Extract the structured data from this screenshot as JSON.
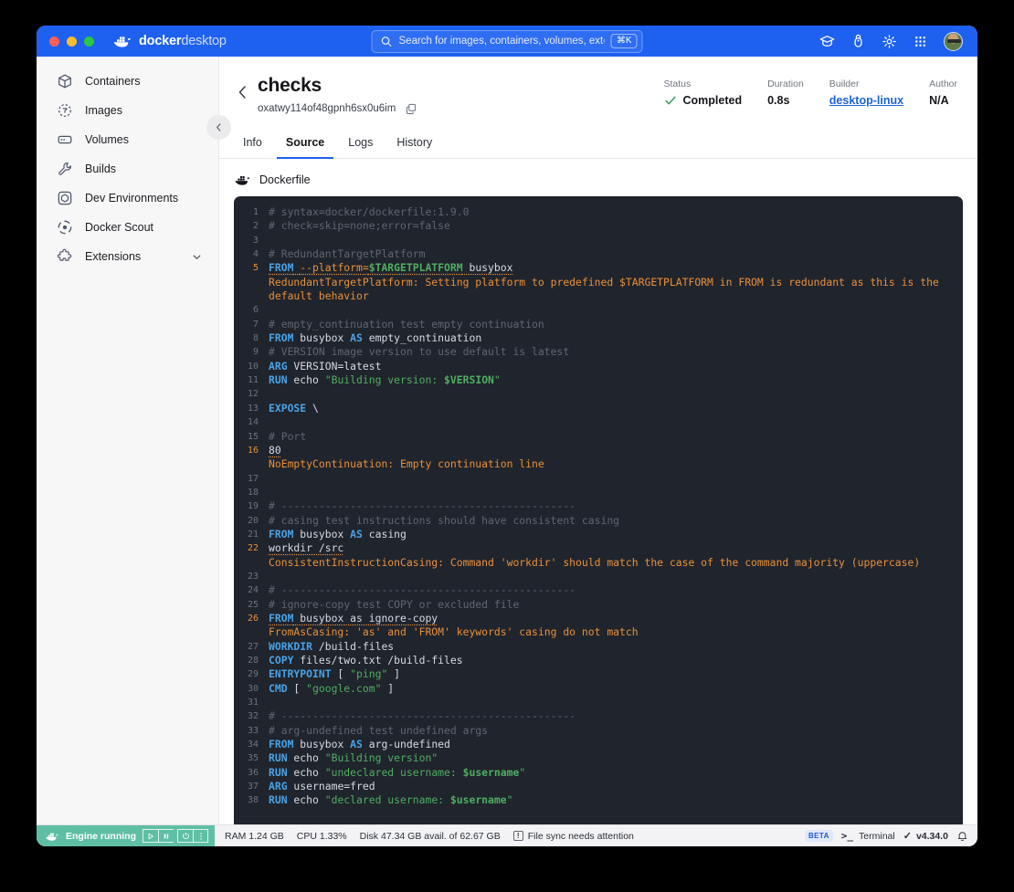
{
  "titlebar": {
    "brand_bold": "docker",
    "brand_light": "desktop",
    "search_placeholder": "Search for images, containers, volumes, extensi…",
    "search_shortcut": "⌘K",
    "icons": [
      "graduation-cap-icon",
      "bug-icon",
      "gear-icon",
      "grid-apps-icon",
      "avatar"
    ]
  },
  "sidebar": {
    "items": [
      {
        "label": "Containers",
        "icon": "container-box-icon"
      },
      {
        "label": "Images",
        "icon": "images-icon"
      },
      {
        "label": "Volumes",
        "icon": "volumes-icon"
      },
      {
        "label": "Builds",
        "icon": "wrench-icon"
      },
      {
        "label": "Dev Environments",
        "icon": "dev-environments-icon"
      },
      {
        "label": "Docker Scout",
        "icon": "docker-scout-icon"
      },
      {
        "label": "Extensions",
        "icon": "puzzle-icon",
        "chevron": "chevron-down-icon"
      }
    ]
  },
  "header": {
    "title": "checks",
    "build_id": "oxatwy114of48gpnh6sx0u6im",
    "copy_icon": "copy-icon",
    "meta": [
      {
        "label": "Status",
        "value": "Completed",
        "icon": "check-icon"
      },
      {
        "label": "Duration",
        "value": "0.8s"
      },
      {
        "label": "Builder",
        "value": "desktop-linux",
        "link": true
      },
      {
        "label": "Author",
        "value": "N/A"
      }
    ]
  },
  "tabs": [
    {
      "label": "Info",
      "active": false
    },
    {
      "label": "Source",
      "active": true
    },
    {
      "label": "Logs",
      "active": false
    },
    {
      "label": "History",
      "active": false
    }
  ],
  "file": {
    "name": "Dockerfile",
    "icon": "docker-whale-icon"
  },
  "code": {
    "lines": [
      {
        "n": "1",
        "tokens": [
          [
            "t-comment",
            "# syntax=docker/dockerfile:1.9.0"
          ]
        ]
      },
      {
        "n": "2",
        "tokens": [
          [
            "t-comment",
            "# check=skip=none;error=false"
          ]
        ]
      },
      {
        "n": "3",
        "tokens": []
      },
      {
        "n": "4",
        "tokens": [
          [
            "t-comment",
            "# RedundantTargetPlatform"
          ]
        ]
      },
      {
        "n": "5",
        "warn": true,
        "underline": true,
        "tokens": [
          [
            "t-kw",
            "FROM"
          ],
          [
            "t-plain",
            " "
          ],
          [
            "t-flag",
            "--platform="
          ],
          [
            "t-var",
            "$TARGETPLATFORM"
          ],
          [
            "t-white",
            " busybox"
          ]
        ]
      },
      {
        "msg": "RedundantTargetPlatform: Setting platform to predefined $TARGETPLATFORM in FROM is redundant as this is the default behavior"
      },
      {
        "n": "6",
        "tokens": []
      },
      {
        "n": "7",
        "tokens": [
          [
            "t-comment",
            "# empty_continuation test empty continuation"
          ]
        ]
      },
      {
        "n": "8",
        "tokens": [
          [
            "t-kw",
            "FROM"
          ],
          [
            "t-white",
            " busybox "
          ],
          [
            "t-kw",
            "AS"
          ],
          [
            "t-white",
            " empty_continuation"
          ]
        ]
      },
      {
        "n": "9",
        "tokens": [
          [
            "t-comment",
            "# VERSION image version to use default is latest"
          ]
        ]
      },
      {
        "n": "10",
        "tokens": [
          [
            "t-kw",
            "ARG"
          ],
          [
            "t-white",
            " VERSION=latest"
          ]
        ]
      },
      {
        "n": "11",
        "tokens": [
          [
            "t-kw",
            "RUN"
          ],
          [
            "t-white",
            " echo "
          ],
          [
            "t-str",
            "\"Building version: "
          ],
          [
            "t-var",
            "$VERSION"
          ],
          [
            "t-str",
            "\""
          ]
        ]
      },
      {
        "n": "12",
        "tokens": []
      },
      {
        "n": "13",
        "tokens": [
          [
            "t-kw",
            "EXPOSE"
          ],
          [
            "t-white",
            " \\"
          ]
        ]
      },
      {
        "n": "14",
        "tokens": []
      },
      {
        "n": "15",
        "tokens": [
          [
            "t-comment",
            "# Port"
          ]
        ]
      },
      {
        "n": "16",
        "warn": true,
        "underline": true,
        "tokens": [
          [
            "t-white",
            "80"
          ]
        ]
      },
      {
        "msg": "NoEmptyContinuation: Empty continuation line"
      },
      {
        "n": "17",
        "tokens": []
      },
      {
        "n": "18",
        "tokens": []
      },
      {
        "n": "19",
        "tokens": [
          [
            "t-comment",
            "# -----------------------------------------------"
          ]
        ]
      },
      {
        "n": "20",
        "tokens": [
          [
            "t-comment",
            "# casing test instructions should have consistent casing"
          ]
        ]
      },
      {
        "n": "21",
        "tokens": [
          [
            "t-kw",
            "FROM"
          ],
          [
            "t-white",
            " busybox "
          ],
          [
            "t-kw",
            "AS"
          ],
          [
            "t-white",
            " casing"
          ]
        ]
      },
      {
        "n": "22",
        "warn": true,
        "underline": true,
        "tokens": [
          [
            "t-white",
            "workdir /src"
          ]
        ]
      },
      {
        "msg": "ConsistentInstructionCasing: Command 'workdir' should match the case of the command majority (uppercase)"
      },
      {
        "n": "23",
        "tokens": []
      },
      {
        "n": "24",
        "tokens": [
          [
            "t-comment",
            "# -----------------------------------------------"
          ]
        ]
      },
      {
        "n": "25",
        "tokens": [
          [
            "t-comment",
            "# ignore-copy test COPY or excluded file"
          ]
        ]
      },
      {
        "n": "26",
        "warn": true,
        "underline": true,
        "tokens": [
          [
            "t-kw",
            "FROM"
          ],
          [
            "t-white",
            " busybox as ignore-copy"
          ]
        ]
      },
      {
        "msg": "FromAsCasing: 'as' and 'FROM' keywords' casing do not match"
      },
      {
        "n": "27",
        "tokens": [
          [
            "t-kw",
            "WORKDIR"
          ],
          [
            "t-white",
            " /build-files"
          ]
        ]
      },
      {
        "n": "28",
        "tokens": [
          [
            "t-kw",
            "COPY"
          ],
          [
            "t-white",
            " files/two.txt /build-files"
          ]
        ]
      },
      {
        "n": "29",
        "tokens": [
          [
            "t-kw",
            "ENTRYPOINT"
          ],
          [
            "t-white",
            " [ "
          ],
          [
            "t-str",
            "\"ping\""
          ],
          [
            "t-white",
            " ]"
          ]
        ]
      },
      {
        "n": "30",
        "tokens": [
          [
            "t-kw",
            "CMD"
          ],
          [
            "t-white",
            " [ "
          ],
          [
            "t-str",
            "\"google.com\""
          ],
          [
            "t-white",
            " ]"
          ]
        ]
      },
      {
        "n": "31",
        "tokens": []
      },
      {
        "n": "32",
        "tokens": [
          [
            "t-comment",
            "# -----------------------------------------------"
          ]
        ]
      },
      {
        "n": "33",
        "tokens": [
          [
            "t-comment",
            "# arg-undefined test undefined args"
          ]
        ]
      },
      {
        "n": "34",
        "tokens": [
          [
            "t-kw",
            "FROM"
          ],
          [
            "t-white",
            " busybox "
          ],
          [
            "t-kw",
            "AS"
          ],
          [
            "t-white",
            " arg-undefined"
          ]
        ]
      },
      {
        "n": "35",
        "tokens": [
          [
            "t-kw",
            "RUN"
          ],
          [
            "t-white",
            " echo "
          ],
          [
            "t-str",
            "\"Building version\""
          ]
        ]
      },
      {
        "n": "36",
        "tokens": [
          [
            "t-kw",
            "RUN"
          ],
          [
            "t-white",
            " echo "
          ],
          [
            "t-str",
            "\"undeclared username: "
          ],
          [
            "t-var",
            "$username"
          ],
          [
            "t-str",
            "\""
          ]
        ]
      },
      {
        "n": "37",
        "tokens": [
          [
            "t-kw",
            "ARG"
          ],
          [
            "t-white",
            " username=fred"
          ]
        ]
      },
      {
        "n": "38",
        "tokens": [
          [
            "t-kw",
            "RUN"
          ],
          [
            "t-white",
            " echo "
          ],
          [
            "t-str",
            "\"declared username: "
          ],
          [
            "t-var",
            "$username"
          ],
          [
            "t-str",
            "\""
          ]
        ]
      }
    ]
  },
  "statusbar": {
    "engine_label": "Engine running",
    "engine_controls": [
      "play-icon",
      "pause-icon",
      "power-icon",
      "kebab-menu-icon"
    ],
    "ram": "RAM 1.24 GB",
    "cpu": "CPU 1.33%",
    "disk": "Disk 47.34 GB avail. of 62.67 GB",
    "sync_message": "File sync needs attention",
    "sync_icon": "warning-icon",
    "beta": "BETA",
    "terminal": "Terminal",
    "terminal_glyph": ">_",
    "version": "v4.34.0",
    "version_icon": "check-icon",
    "bell": "bell-icon"
  },
  "colors": {
    "brand_blue": "#1e61f0",
    "editor_bg": "#20242c",
    "warning_orange": "#e8913c",
    "keyword_blue": "#4aa3e8",
    "string_green": "#4fae62",
    "comment_grey": "#5f6672",
    "engine_green": "#5fbfa5"
  }
}
